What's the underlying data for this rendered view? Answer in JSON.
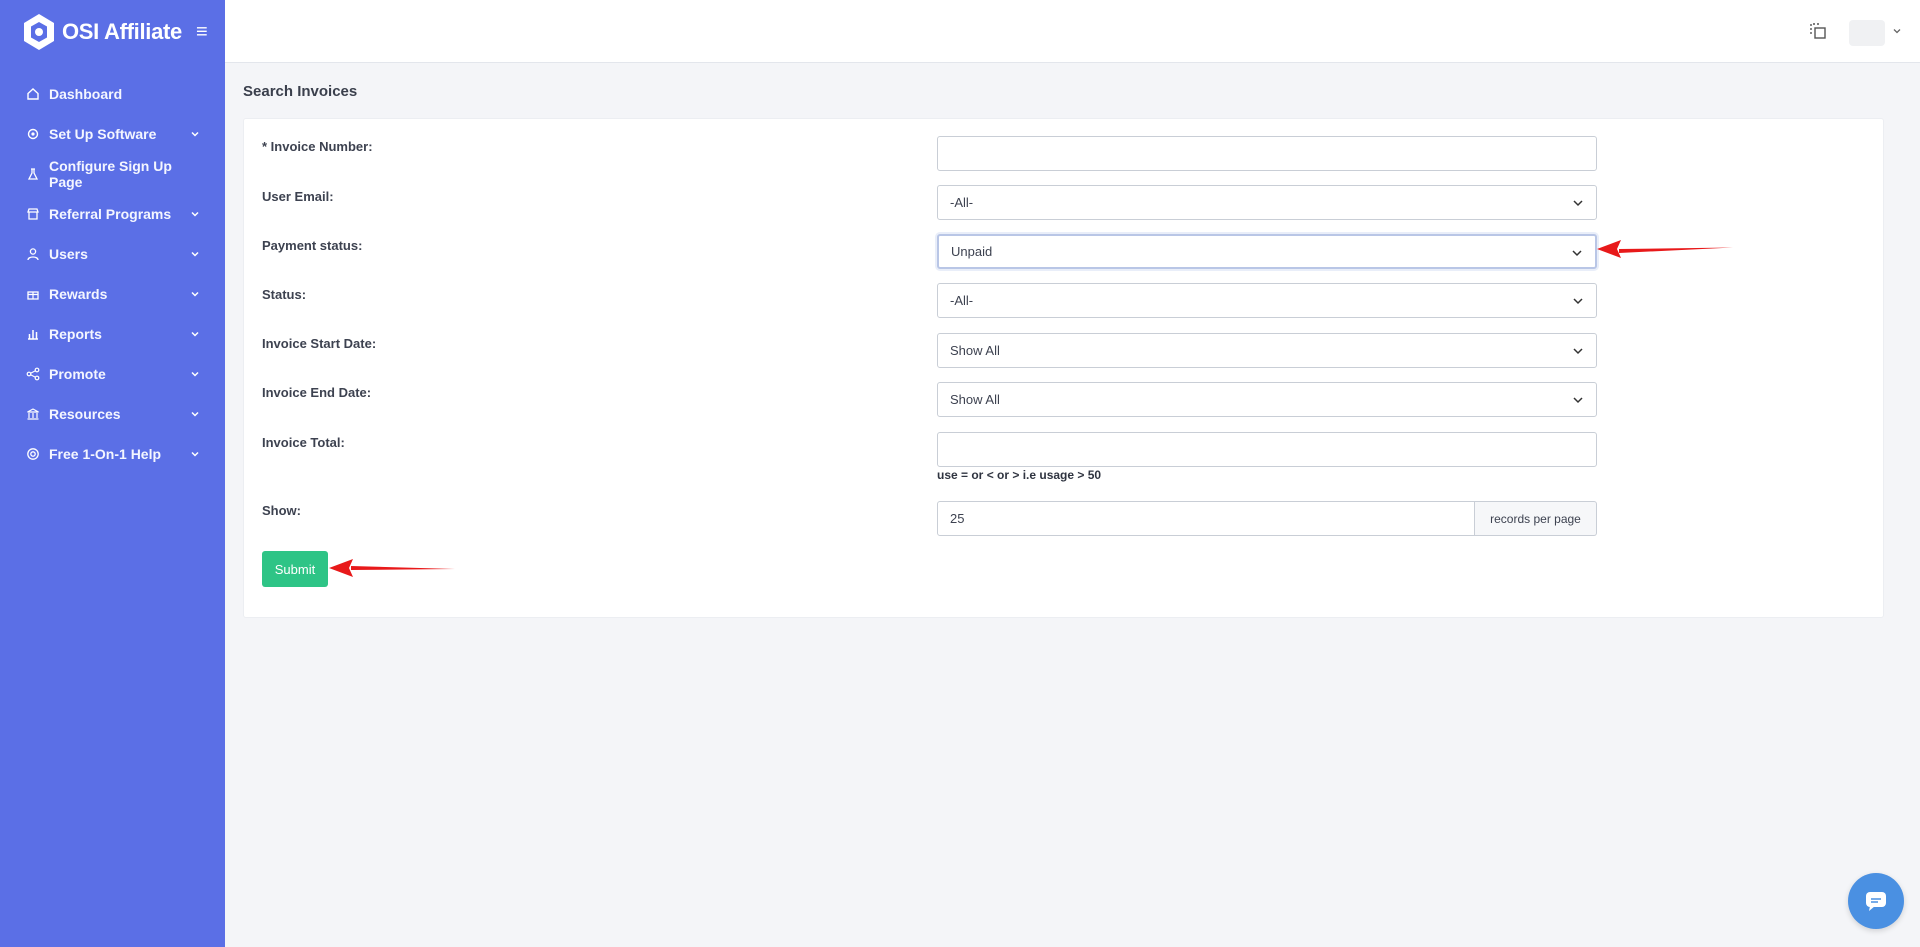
{
  "app": {
    "brand": "OSI Affiliate"
  },
  "sidebar": {
    "items": [
      {
        "label": "Dashboard",
        "icon": "home-icon"
      },
      {
        "label": "Set Up Software",
        "icon": "gear-icon"
      },
      {
        "label": "Configure Sign Up Page",
        "icon": "flask-icon"
      },
      {
        "label": "Referral Programs",
        "icon": "store-icon"
      },
      {
        "label": "Users",
        "icon": "user-icon"
      },
      {
        "label": "Rewards",
        "icon": "gift-icon"
      },
      {
        "label": "Reports",
        "icon": "chart-icon"
      },
      {
        "label": "Promote",
        "icon": "share-icon"
      },
      {
        "label": "Resources",
        "icon": "bank-icon"
      },
      {
        "label": "Free 1-On-1 Help",
        "icon": "lifebuoy-icon"
      }
    ]
  },
  "page": {
    "title": "Search Invoices"
  },
  "form": {
    "invoice_number": {
      "label": "* Invoice Number:",
      "value": ""
    },
    "user_email": {
      "label": "User Email:",
      "value": "-All-"
    },
    "payment_status": {
      "label": "Payment status:",
      "value": "Unpaid"
    },
    "status": {
      "label": "Status:",
      "value": "-All-"
    },
    "start_date": {
      "label": "Invoice Start Date:",
      "value": "Show All"
    },
    "end_date": {
      "label": "Invoice End Date:",
      "value": "Show All"
    },
    "total": {
      "label": "Invoice Total:",
      "value": "",
      "hint": "use = or < or > i.e usage > 50"
    },
    "show": {
      "label": "Show:",
      "value": "25",
      "addon": "records per page"
    },
    "submit_label": "Submit"
  },
  "colors": {
    "sidebar": "#5b6fe6",
    "submit": "#2ec486",
    "annotation_arrow": "#e8191a",
    "chat": "#4a90e2"
  }
}
